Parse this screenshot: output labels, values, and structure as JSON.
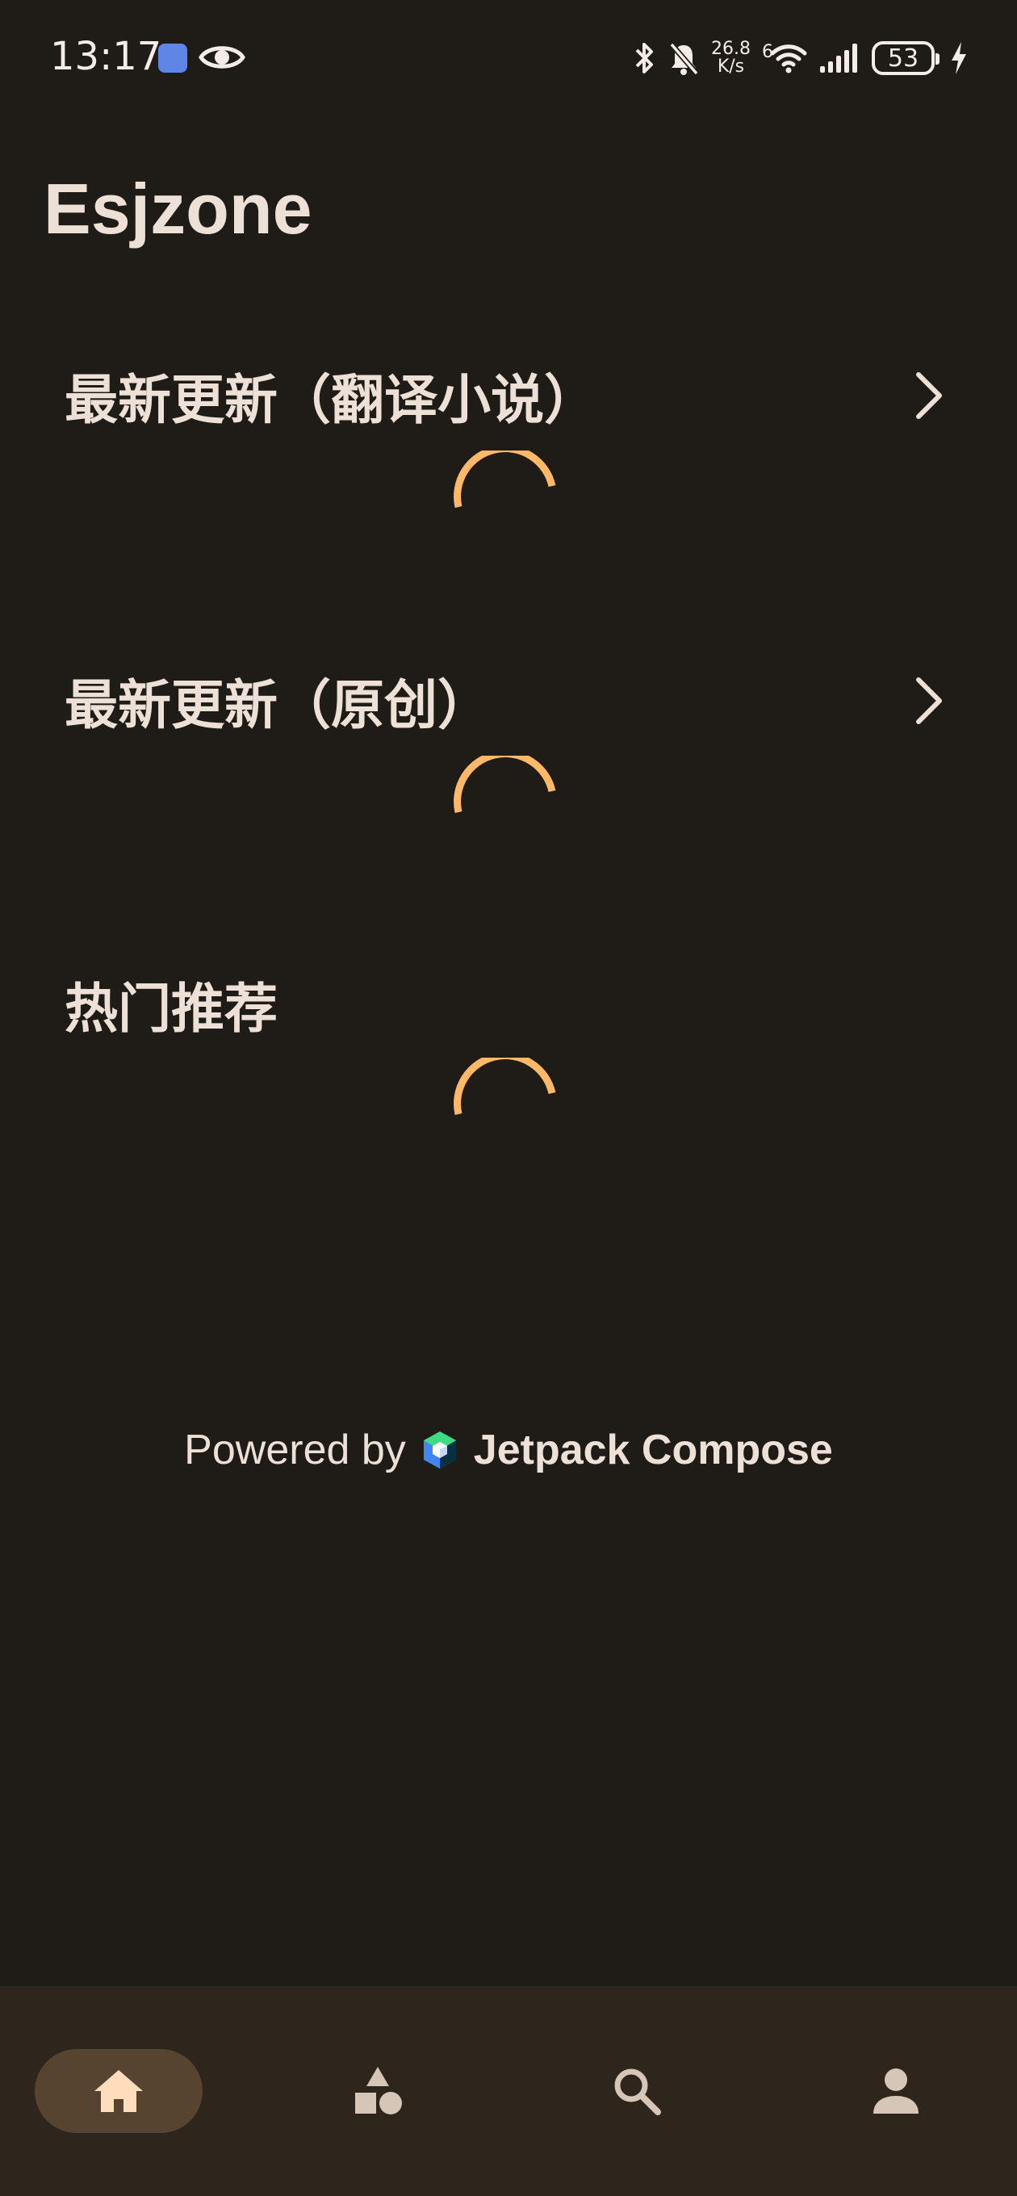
{
  "status_bar": {
    "time": "13:17",
    "net_speed_value": "26.8",
    "net_speed_unit": "K/s",
    "network_type": "6",
    "battery_level": "53",
    "icons": [
      "app-notification-icon",
      "eye-icon",
      "bluetooth-icon",
      "bell-off-icon",
      "wifi-icon",
      "signal-icon",
      "battery-icon",
      "charging-icon"
    ]
  },
  "header": {
    "title": "Esjzone"
  },
  "sections": [
    {
      "title": "最新更新（翻译小说）",
      "has_more": true,
      "state": "loading"
    },
    {
      "title": "最新更新（原创）",
      "has_more": true,
      "state": "loading"
    },
    {
      "title": "热门推荐",
      "has_more": false,
      "state": "loading"
    }
  ],
  "footer": {
    "prefix": "Powered by",
    "brand": "Jetpack Compose"
  },
  "bottom_nav": {
    "items": [
      {
        "icon": "home-icon",
        "active": true
      },
      {
        "icon": "categories-icon",
        "active": false
      },
      {
        "icon": "search-icon",
        "active": false
      },
      {
        "icon": "profile-icon",
        "active": false
      }
    ]
  },
  "colors": {
    "background": "#1f1b17",
    "text": "#ece0d7",
    "accent_spinner": "#ffb868",
    "nav_background": "#2e251d",
    "nav_active_pill": "#574430",
    "nav_active_icon": "#ffdcbb",
    "nav_inactive_icon": "#d6c6b8"
  }
}
